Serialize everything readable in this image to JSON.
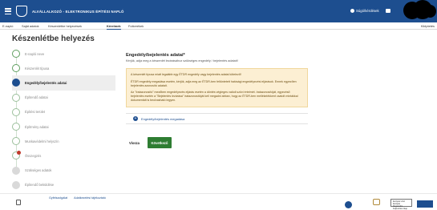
{
  "header": {
    "app_title": "ALVÁLLALKOZÓ - ELEKTRONIKUS ÉPÍTÉSI NAPLÓ",
    "help_label": "Súgó/kérdések"
  },
  "tabs": [
    {
      "label": "E-napló"
    },
    {
      "label": "Saját adatok"
    },
    {
      "label": "Készenlétbe helyezések"
    },
    {
      "label": "Kérelmek"
    },
    {
      "label": "Futkerékek"
    }
  ],
  "logout_label": "Kiléptetés",
  "page_title": "Készenlétbe helyezés",
  "steps": [
    {
      "label": "E-napló neve",
      "state": "done"
    },
    {
      "label": "Készenlét típusa",
      "state": "done"
    },
    {
      "label": "Engedély/bejelentés adatai",
      "state": "active"
    },
    {
      "label": "Építendő adatai",
      "state": "pending"
    },
    {
      "label": "Építési terület",
      "state": "pending"
    },
    {
      "label": "Építmény adatai",
      "state": "pending"
    },
    {
      "label": "Munkavédelmi helyszín",
      "state": "pending"
    },
    {
      "label": "Összegzés",
      "state": "error"
    },
    {
      "label": "Szükséges adatok",
      "state": "disabled"
    },
    {
      "label": "Építendő beküldése",
      "state": "disabled"
    }
  ],
  "section": {
    "title": "Engedély/bejelentés adatai*",
    "subtitle": "Kérjük, adja meg a készenlét lezárásához szükséges engedély / bejelentés adatait!",
    "warning": [
      "A készenlét típusa miatt legalább egy ÉTDR engedély vagy bejelentés adatai kötelező!",
      "ÉTDR engedély megadása esetén, kérjük, adja meg az ÉTDR-ben feltüntetett hatósági engedélyezési eljárások. Ennek egyezően bejelentés azonosító adatait.",
      "Az \"Iratazonosító\" mezőben engedélyezés eljárás esetén a döntés végleges valódi szövi értelmét. Iratazonosítóját, egyezéső bejelentés esetén a \"Bejelentés lezárása\" iratazonosítóját kell megadni abban, hogy az ÉTDR-ben mellékelékkent csatolt mintákkal dokumentált is beolvasható legyen."
    ],
    "add_label": "Engedély/bejelentés megadása"
  },
  "buttons": {
    "back": "Vissza",
    "next": "Következő"
  },
  "footer": {
    "links": [
      "Gyfélszolgálat",
      "Adatkezelési tájékoztató"
    ],
    "eu_text": "Európai Unió Európai Regionális Fejlesztési Alap"
  },
  "colors": {
    "primary": "#1d4e8f",
    "success": "#2e7d32",
    "warning_bg": "#fcefd3",
    "error": "#c0392b"
  }
}
